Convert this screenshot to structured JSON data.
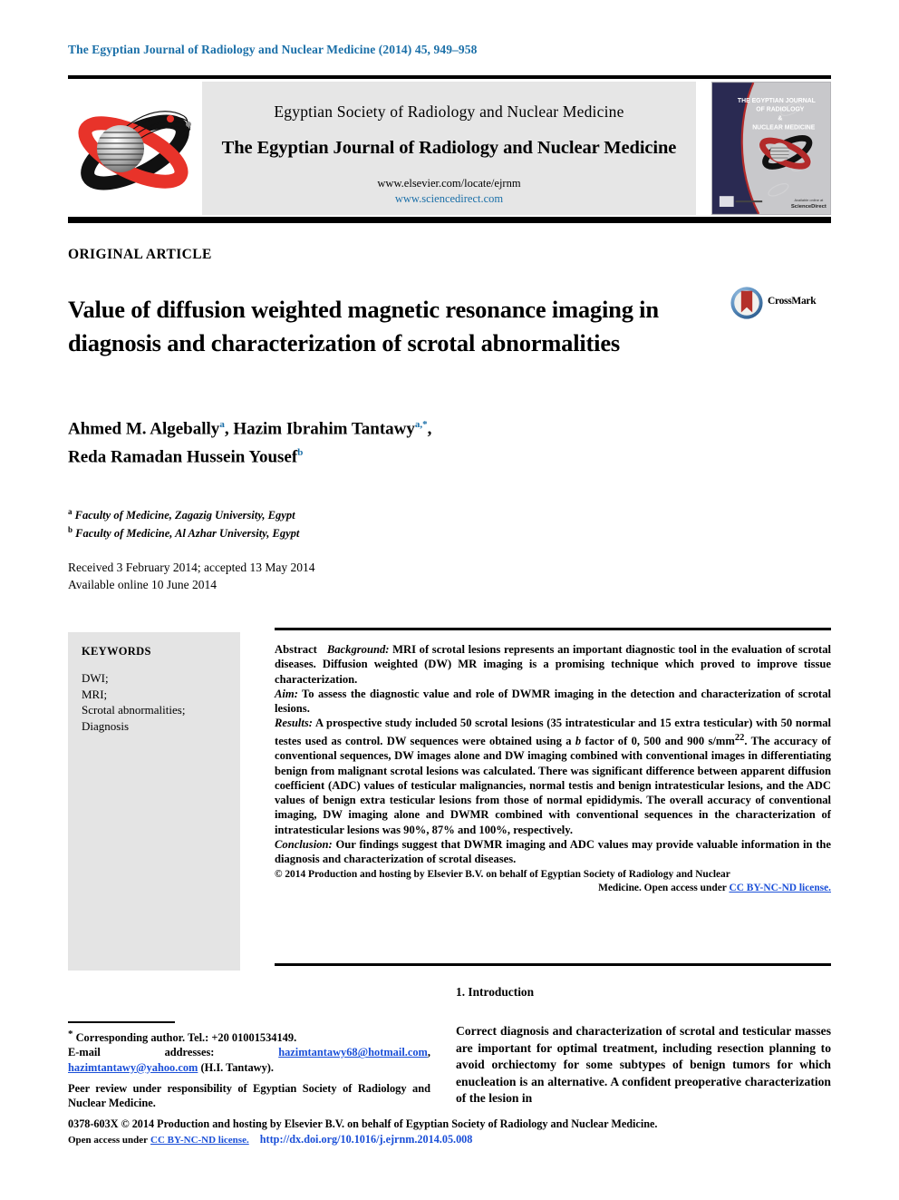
{
  "running_head": "The Egyptian Journal of Radiology and Nuclear Medicine (2014) 45, 949–958",
  "header": {
    "society_name": "Egyptian Society of Radiology and Nuclear Medicine",
    "journal_name": "The Egyptian Journal of Radiology and Nuclear Medicine",
    "url_elsevier": "www.elsevier.com/locate/ejrnm",
    "url_sciencedirect": "www.sciencedirect.com",
    "society_logo_icon": "orbit-sphere-logo-icon",
    "cover_icon": "journal-cover-thumbnail",
    "cover_title_line1": "THE EGYPTIAN JOURNAL",
    "cover_title_line2": "OF RADIOLOGY",
    "cover_title_line3": "&",
    "cover_title_line4": "NUCLEAR MEDICINE"
  },
  "article": {
    "type": "ORIGINAL ARTICLE",
    "title": "Value of diffusion weighted magnetic resonance imaging in diagnosis and characterization of scrotal abnormalities",
    "crossmark_label": "CrossMark",
    "crossmark_icon": "crossmark-badge-icon",
    "authors_line1_a": "Ahmed M. Algebally",
    "authors_line1_a_sup": "a",
    "authors_line1_b": "Hazim Ibrahim Tantawy",
    "authors_line1_b_sup": "a,*",
    "authors_line2": "Reda Ramadan Hussein Yousef",
    "authors_line2_sup": "b",
    "affiliation_a_sup": "a",
    "affiliation_a": "Faculty of Medicine, Zagazig University, Egypt",
    "affiliation_b_sup": "b",
    "affiliation_b": "Faculty of Medicine, Al Azhar University, Egypt",
    "received": "Received 3 February 2014; accepted 13 May 2014",
    "available": "Available online 10 June 2014"
  },
  "keywords": {
    "heading": "KEYWORDS",
    "items": [
      "DWI;",
      "MRI;",
      "Scrotal abnormalities;",
      "Diagnosis"
    ]
  },
  "abstract": {
    "label": "Abstract",
    "background_label": "Background:",
    "background_text": "MRI of scrotal lesions represents an important diagnostic tool in the evaluation of scrotal diseases. Diffusion weighted (DW) MR imaging is a promising technique which proved to improve tissue characterization.",
    "aim_label": "Aim:",
    "aim_text": "To assess the diagnostic value and role of DWMR imaging in the detection and characterization of scrotal lesions.",
    "results_label": "Results:",
    "results_text_1": "A prospective study included 50 scrotal lesions (35 intratesticular and 15 extra testicular) with 50 normal testes used as control. DW sequences were obtained using a",
    "results_b_italic": "b",
    "results_text_2": "factor of 0, 500 and 900 s/mm",
    "results_sup": "22",
    "results_text_3": ". The accuracy of conventional sequences, DW images alone and DW imaging combined with conventional images in differentiating benign from malignant scrotal lesions was calculated. There was significant difference between apparent diffusion coefficient (ADC) values of testicular malignancies, normal testis and benign intratesticular lesions, and the ADC values of benign extra testicular lesions from those of normal epididymis. The overall accuracy of conventional imaging, DW imaging alone and DWMR combined with conventional sequences in the characterization of intratesticular lesions was 90%, 87% and 100%, respectively.",
    "conclusion_label": "Conclusion:",
    "conclusion_text": "Our findings suggest that DWMR imaging and ADC values may provide valuable information in the diagnosis and characterization of scrotal diseases.",
    "copyright_lead": "© 2014 Production and hosting by Elsevier B.V. on behalf of Egyptian Society of Radiology and Nuclear",
    "copyright_tail": "Medicine. Open access under",
    "copyright_license": "CC BY-NC-ND license."
  },
  "footnotes": {
    "corresponding_star": "*",
    "corresponding": "Corresponding author. Tel.: +20 01001534149.",
    "email_label": "E-mail addresses:",
    "email1": "hazimtantawy68@hotmail.com",
    "email_sep": ",",
    "email2": "hazimtantawy@yahoo.com",
    "email_owner": "(H.I. Tantawy).",
    "peer_review": "Peer review under responsibility of Egyptian Society of Radiology and Nuclear Medicine."
  },
  "intro": {
    "heading": "1. Introduction",
    "paragraph": "Correct diagnosis and characterization of scrotal and testicular masses are important for optimal treatment, including resection planning to avoid orchiectomy for some subtypes of benign tumors for which enucleation is an alternative. A confident preoperative characterization of the lesion in"
  },
  "legal": {
    "issn_line": "0378-603X © 2014 Production and hosting by Elsevier B.V. on behalf of Egyptian Society of Radiology and Nuclear Medicine.",
    "open_access": "Open access under",
    "license": "CC BY-NC-ND license.",
    "doi": "http://dx.doi.org/10.1016/j.ejrnm.2014.05.008"
  },
  "colors": {
    "running_head_blue": "#1a6fa8",
    "link_blue": "#1a4fd8",
    "band_grey": "#e6e6e6",
    "keyword_grey": "#e4e4e4",
    "logo_red": "#e8332a",
    "logo_black": "#111111"
  }
}
